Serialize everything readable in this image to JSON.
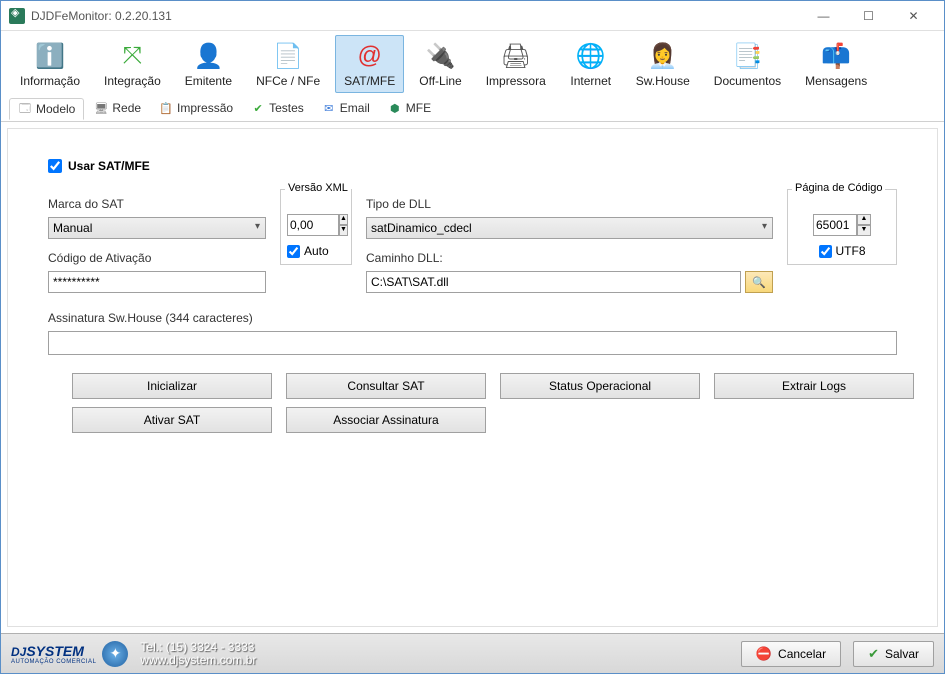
{
  "window": {
    "title": "DJDFeMonitor: 0.2.20.131"
  },
  "toolbar": [
    {
      "id": "informacao",
      "label": "Informação",
      "icon": "ℹ️",
      "color": "#1a8cd8"
    },
    {
      "id": "integracao",
      "label": "Integração",
      "icon": "⤧",
      "color": "#3aaa3a"
    },
    {
      "id": "emitente",
      "label": "Emitente",
      "icon": "👤",
      "color": "#8a6a4a"
    },
    {
      "id": "nfce",
      "label": "NFCe / NFe",
      "icon": "📄",
      "color": "#6a8ad8"
    },
    {
      "id": "satmfe",
      "label": "SAT/MFE",
      "icon": "@",
      "color": "#e03030",
      "active": true
    },
    {
      "id": "offline",
      "label": "Off-Line",
      "icon": "🔌",
      "color": "#888"
    },
    {
      "id": "impressora",
      "label": "Impressora",
      "icon": "🖨",
      "color": "#555"
    },
    {
      "id": "internet",
      "label": "Internet",
      "icon": "🌐",
      "color": "#2a9a3a"
    },
    {
      "id": "swhouse",
      "label": "Sw.House",
      "icon": "👩‍💼",
      "color": "#8a5a3a"
    },
    {
      "id": "documentos",
      "label": "Documentos",
      "icon": "📑",
      "color": "#888"
    },
    {
      "id": "mensagens",
      "label": "Mensagens",
      "icon": "📫",
      "color": "#a03030"
    }
  ],
  "tabs": [
    {
      "id": "modelo",
      "label": "Modelo",
      "icon": "🗔",
      "active": true
    },
    {
      "id": "rede",
      "label": "Rede",
      "icon": "🖥"
    },
    {
      "id": "impressao",
      "label": "Impressão",
      "icon": "📋"
    },
    {
      "id": "testes",
      "label": "Testes",
      "icon": "✔",
      "iconColor": "#3aaa3a"
    },
    {
      "id": "email",
      "label": "Email",
      "icon": "✉",
      "iconColor": "#3a7ad8"
    },
    {
      "id": "mfe",
      "label": "MFE",
      "icon": "⬢",
      "iconColor": "#2a8a5a"
    }
  ],
  "form": {
    "useSatLabel": "Usar SAT/MFE",
    "useSatChecked": true,
    "marca": {
      "label": "Marca do SAT",
      "value": "Manual"
    },
    "versao": {
      "label": "Versão XML",
      "value": "0,00",
      "autoLabel": "Auto",
      "autoChecked": true
    },
    "tipoDll": {
      "label": "Tipo de DLL",
      "value": "satDinamico_cdecl"
    },
    "caminho": {
      "label": "Caminho DLL:",
      "value": "C:\\SAT\\SAT.dll"
    },
    "pagina": {
      "label": "Página de Código",
      "value": "65001",
      "utf8Label": "UTF8",
      "utf8Checked": true
    },
    "codigo": {
      "label": "Código de Ativação",
      "value": "**********"
    },
    "assinatura": {
      "label": "Assinatura Sw.House (344 caracteres)",
      "value": ""
    }
  },
  "buttons": {
    "inicializar": "Inicializar",
    "consultar": "Consultar SAT",
    "status": "Status Operacional",
    "extrair": "Extrair Logs",
    "ativar": "Ativar SAT",
    "associar": "Associar Assinatura"
  },
  "footer": {
    "logo1": "DJ",
    "logo2": "SYSTEM",
    "logoSub": "AUTOMAÇÃO COMERCIAL",
    "tel": "Tel.: (15) 3324 - 3333",
    "site": "www.djsystem.com.br",
    "cancel": "Cancelar",
    "save": "Salvar"
  }
}
